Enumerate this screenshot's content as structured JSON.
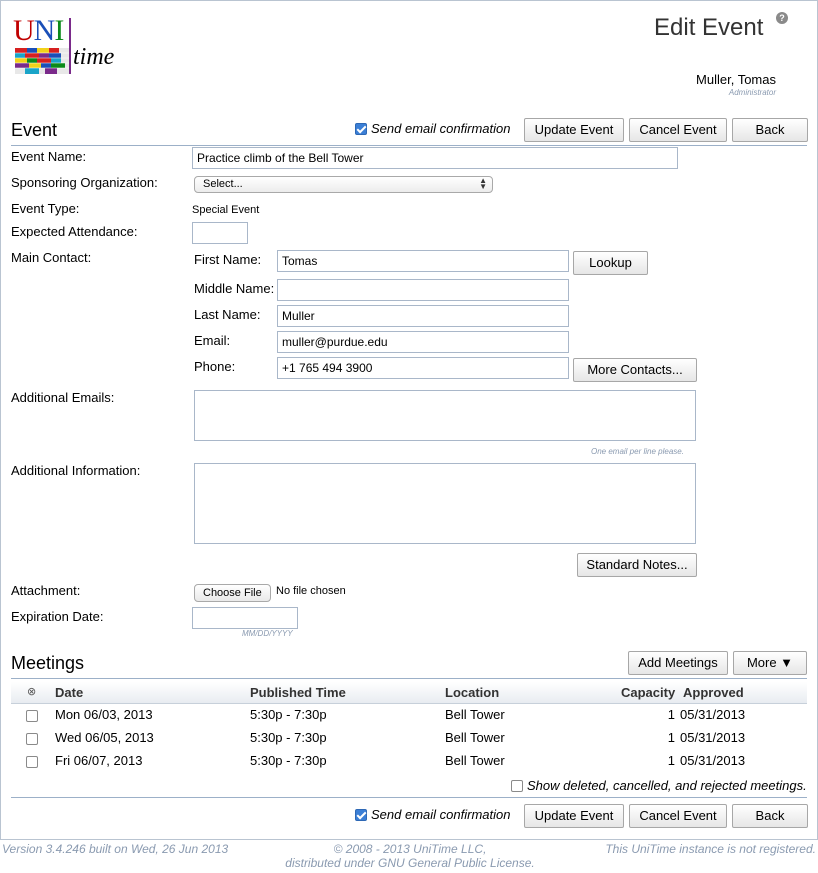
{
  "header": {
    "logo": {
      "text_u": "U",
      "text_n": "N",
      "text_i": "I",
      "text_time": "time",
      "icon": "unitime-logo"
    },
    "title": "Edit Event",
    "help_icon": "help-icon",
    "user_name": "Muller, Tomas",
    "user_role": "Administrator"
  },
  "event_section": {
    "title": "Event",
    "send_email_label": "Send email confirmation",
    "send_email_checked": true,
    "update_button": "Update Event",
    "cancel_button": "Cancel Event",
    "back_button": "Back"
  },
  "form": {
    "event_name_label": "Event Name:",
    "event_name_value": "Practice climb of the Bell Tower",
    "sponsor_label": "Sponsoring Organization:",
    "sponsor_value": "Select...",
    "event_type_label": "Event Type:",
    "event_type_value": "Special Event",
    "attendance_label": "Expected Attendance:",
    "attendance_value": "",
    "main_contact_label": "Main Contact:",
    "first_name_label": "First Name:",
    "first_name_value": "Tomas",
    "lookup_button": "Lookup",
    "middle_name_label": "Middle Name:",
    "middle_name_value": "",
    "last_name_label": "Last Name:",
    "last_name_value": "Muller",
    "email_label": "Email:",
    "email_value": "muller@purdue.edu",
    "phone_label": "Phone:",
    "phone_value": "+1 765 494 3900",
    "more_contacts_button": "More Contacts...",
    "additional_emails_label": "Additional Emails:",
    "additional_emails_hint": "One email per line please.",
    "additional_info_label": "Additional Information:",
    "standard_notes_button": "Standard Notes...",
    "attachment_label": "Attachment:",
    "choose_file_button": "Choose File",
    "no_file_text": "No file chosen",
    "expiration_label": "Expiration Date:",
    "expiration_value": "",
    "expiration_hint": "MM/DD/YYYY"
  },
  "meetings_section": {
    "title": "Meetings",
    "add_meetings_button": "Add Meetings",
    "more_button": "More ▼",
    "columns": {
      "select": "⊗",
      "date": "Date",
      "published_time": "Published Time",
      "location": "Location",
      "capacity": "Capacity",
      "approved": "Approved"
    },
    "rows": [
      {
        "date": "Mon 06/03, 2013",
        "time": "5:30p - 7:30p",
        "location": "Bell Tower",
        "capacity": "1",
        "approved": "05/31/2013"
      },
      {
        "date": "Wed 06/05, 2013",
        "time": "5:30p - 7:30p",
        "location": "Bell Tower",
        "capacity": "1",
        "approved": "05/31/2013"
      },
      {
        "date": "Fri 06/07, 2013",
        "time": "5:30p - 7:30p",
        "location": "Bell Tower",
        "capacity": "1",
        "approved": "05/31/2013"
      }
    ],
    "show_deleted_label": "Show deleted, cancelled, and rejected meetings."
  },
  "bottom_bar": {
    "send_email_label": "Send email confirmation",
    "send_email_checked": true,
    "update_button": "Update Event",
    "cancel_button": "Cancel Event",
    "back_button": "Back"
  },
  "footer": {
    "version": "Version 3.4.246 built on Wed, 26 Jun 2013",
    "copyright_line1": "© 2008 - 2013 UniTime LLC,",
    "copyright_line2": "distributed under GNU General Public License.",
    "registration": "This UniTime instance is not registered."
  },
  "colors": {
    "accent": "#3b7fd6",
    "rule": "#9cb0c8",
    "hint_text": "#8a9ab0",
    "logo_red": "#c00000",
    "logo_blue": "#1a4fb8",
    "logo_green": "#0c8a1a"
  }
}
